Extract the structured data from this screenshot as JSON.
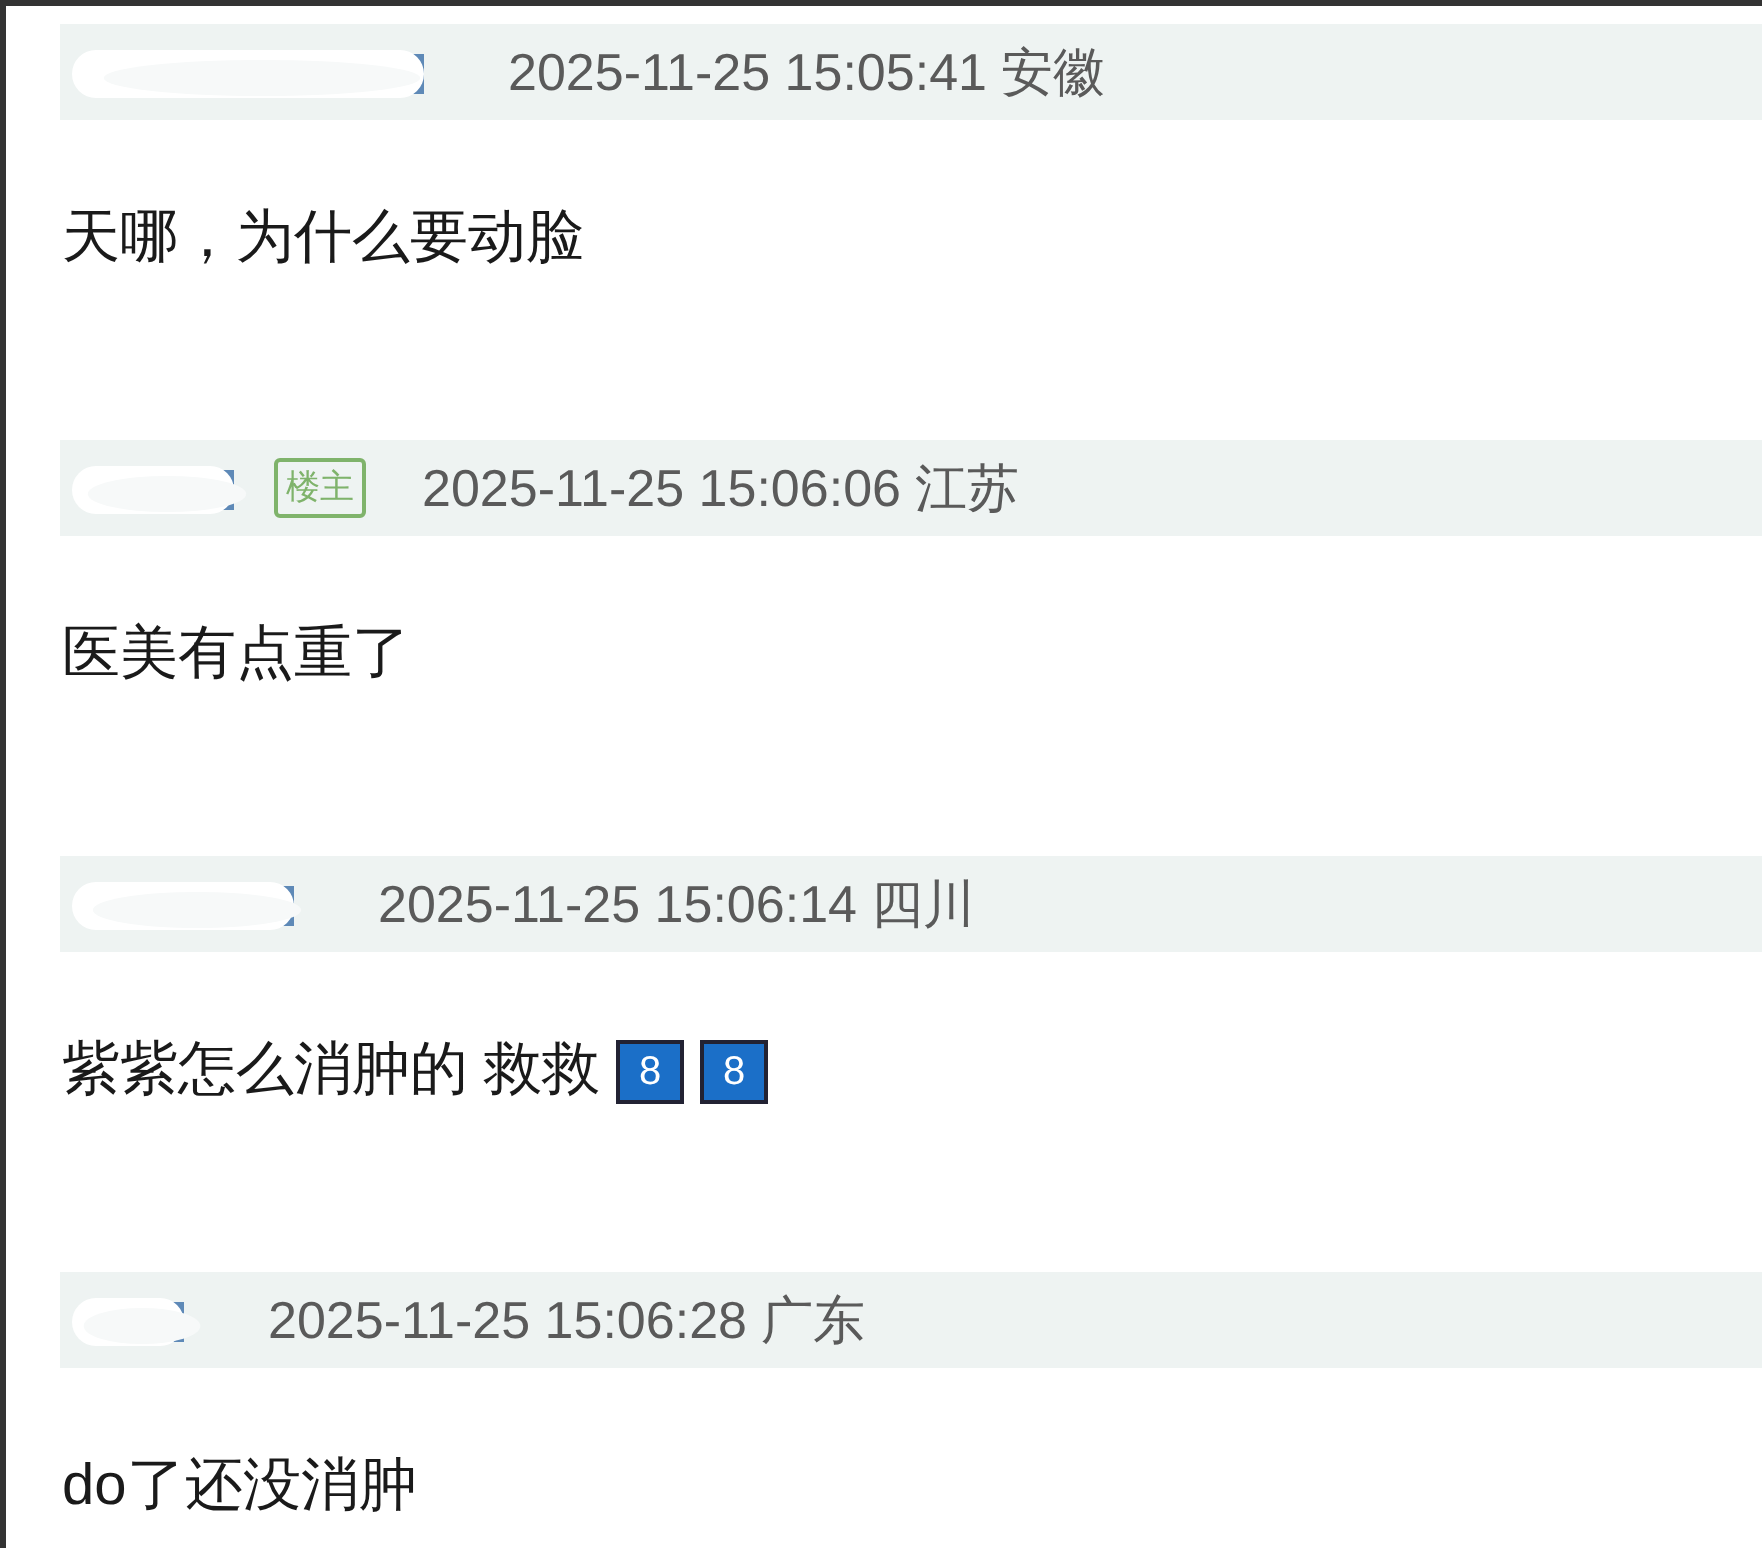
{
  "comments": [
    {
      "time": "2025-11-25 15:05:41 安徽",
      "text": "天哪，为什么要动脸"
    },
    {
      "badge": "楼主",
      "time": "2025-11-25 15:06:06 江苏",
      "text": "医美有点重了"
    },
    {
      "time": "2025-11-25 15:06:14 四川",
      "text": "紫紫怎么消肿的 救救",
      "keycaps": [
        "8",
        "8"
      ]
    },
    {
      "time": "2025-11-25 15:06:28 广东",
      "text": "do了还没消肿"
    }
  ]
}
